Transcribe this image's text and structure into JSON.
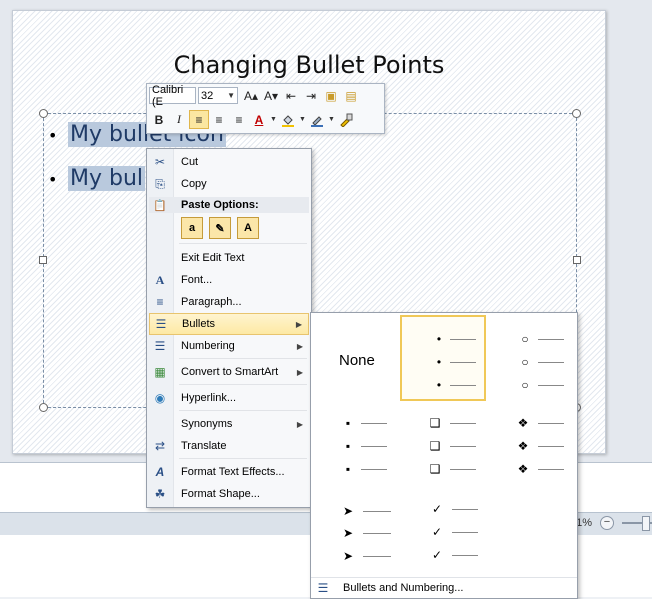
{
  "slide": {
    "title": "Changing Bullet Points",
    "bullets": [
      {
        "symbol": "•",
        "text": "My bullet icon"
      },
      {
        "symbol": "•",
        "text": "My bul"
      }
    ]
  },
  "mini_toolbar": {
    "font_name": "Calibri (E",
    "font_size": "32",
    "buttons": [
      {
        "name": "grow-font",
        "glyph": "A▴"
      },
      {
        "name": "shrink-font",
        "glyph": "A▾"
      },
      {
        "name": "decrease-indent",
        "glyph": "⇤"
      },
      {
        "name": "increase-indent",
        "glyph": "⇥"
      },
      {
        "name": "bring-to-front",
        "glyph": "▣"
      },
      {
        "name": "send-to-back",
        "glyph": "▤"
      }
    ],
    "row2": {
      "bold": "B",
      "italic": "I",
      "align_left": "≡",
      "align_center": "≡",
      "align_right": "≡",
      "font_color": "A",
      "format_painter": "🖌"
    },
    "accent_color": "#e0b64c"
  },
  "context_menu": {
    "items": [
      {
        "id": "cut",
        "icon": "✂",
        "label": "Cut"
      },
      {
        "id": "copy",
        "icon": "⎘",
        "label": "Copy"
      }
    ],
    "paste_options_label": "Paste Options:",
    "paste_buttons": [
      "a",
      "✎",
      "A"
    ],
    "items2": [
      {
        "id": "exit-edit-text",
        "icon": "",
        "label": "Exit Edit Text",
        "submenu": false
      },
      {
        "id": "font",
        "icon": "A",
        "label": "Font...",
        "submenu": false
      },
      {
        "id": "paragraph",
        "icon": "≡",
        "label": "Paragraph...",
        "submenu": false
      },
      {
        "id": "bullets",
        "icon": "☰",
        "label": "Bullets",
        "submenu": true,
        "highlighted": true
      },
      {
        "id": "numbering",
        "icon": "☰",
        "label": "Numbering",
        "submenu": true
      },
      {
        "id": "convert-smartart",
        "icon": "▦",
        "label": "Convert to SmartArt",
        "submenu": true
      },
      {
        "id": "hyperlink",
        "icon": "◉",
        "label": "Hyperlink...",
        "submenu": false
      },
      {
        "id": "synonyms",
        "icon": "",
        "label": "Synonyms",
        "submenu": true
      },
      {
        "id": "translate",
        "icon": "⇄",
        "label": "Translate",
        "submenu": false
      },
      {
        "id": "format-text-effects",
        "icon": "A",
        "label": "Format Text Effects...",
        "submenu": false
      },
      {
        "id": "format-shape",
        "icon": "☘",
        "label": "Format Shape...",
        "submenu": false
      }
    ],
    "submenu_arrow": "▶"
  },
  "bullet_gallery": {
    "none_label": "None",
    "styles": [
      {
        "id": "none",
        "glyph": ""
      },
      {
        "id": "filled-round",
        "glyph": "•"
      },
      {
        "id": "hollow-round",
        "glyph": "○"
      },
      {
        "id": "filled-square",
        "glyph": "▪"
      },
      {
        "id": "hollow-square",
        "glyph": "❑"
      },
      {
        "id": "star",
        "glyph": "❖"
      },
      {
        "id": "arrow",
        "glyph": "➤"
      },
      {
        "id": "checkmark",
        "glyph": "✓"
      }
    ],
    "selected": "filled-round",
    "footer_label": "Bullets and Numbering...",
    "footer_icon": "☰"
  },
  "status_bar": {
    "zoom_text": "1%",
    "zoom_minus": "−"
  }
}
